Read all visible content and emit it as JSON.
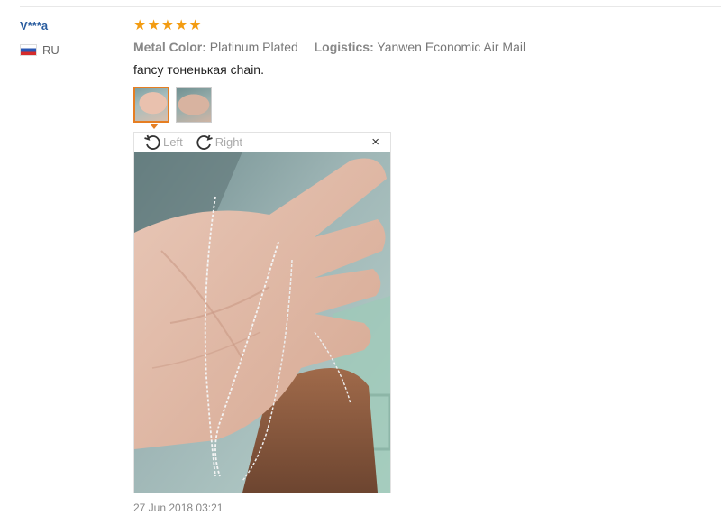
{
  "review": {
    "author": "V***a",
    "country": "RU",
    "rating": 5,
    "star_glyph": "★",
    "attributes": [
      {
        "label": "Metal Color:",
        "value": "Platinum Plated"
      },
      {
        "label": "Logistics:",
        "value": "Yanwen Economic Air Mail"
      }
    ],
    "text": "fancy тоненькая chain.",
    "date": "27 Jun 2018 03:21"
  },
  "viewer": {
    "rotate_left_label": "Left",
    "rotate_right_label": "Right",
    "close_glyph": "×"
  },
  "icons": {
    "flag": "russia-flag-icon",
    "rotate_left": "rotate-left-icon",
    "rotate_right": "rotate-right-icon",
    "close": "close-icon",
    "star": "star-icon"
  },
  "colors": {
    "author": "#2a5d9f",
    "star": "#f39c12",
    "active_thumb": "#e67e22"
  }
}
